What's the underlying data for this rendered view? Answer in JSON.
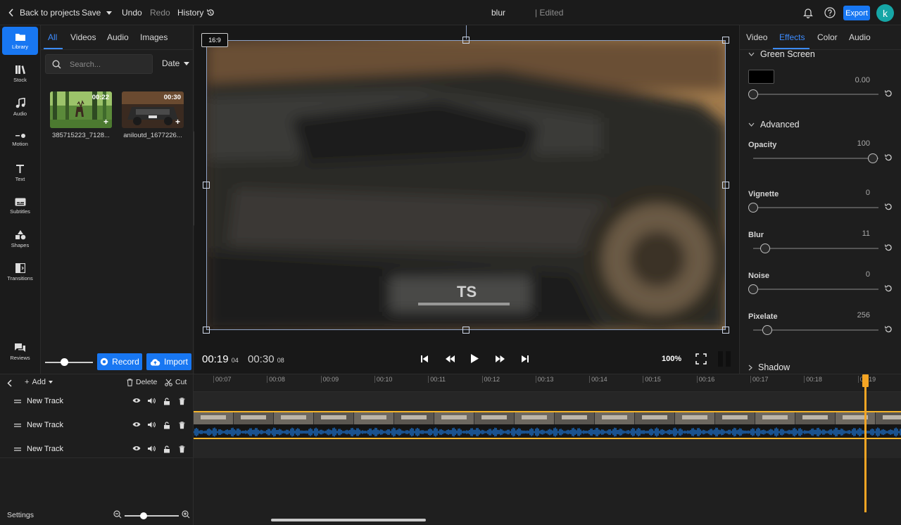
{
  "topbar": {
    "back_label": "Back to projects",
    "save_label": "Save",
    "undo_label": "Undo",
    "redo_label": "Redo",
    "history_label": "History",
    "project_title": "blur",
    "edit_status": "| Edited",
    "export_label": "Export",
    "avatar_initial": "k"
  },
  "rail": {
    "items": [
      {
        "label": "Library",
        "icon": "folder-icon"
      },
      {
        "label": "Stock",
        "icon": "books-icon"
      },
      {
        "label": "Audio",
        "icon": "music-note-icon"
      },
      {
        "label": "Motion",
        "icon": "motion-icon"
      },
      {
        "label": "Text",
        "icon": "text-icon"
      },
      {
        "label": "Subtitles",
        "icon": "subtitles-icon"
      },
      {
        "label": "Shapes",
        "icon": "shapes-icon"
      },
      {
        "label": "Transitions",
        "icon": "transitions-icon"
      },
      {
        "label": "Reviews",
        "icon": "chat-icon"
      }
    ]
  },
  "library": {
    "tabs": [
      "All",
      "Videos",
      "Audio",
      "Images"
    ],
    "search_placeholder": "Search...",
    "sort_label": "Date",
    "media": [
      {
        "name": "385715223_7128...",
        "duration": "00:22"
      },
      {
        "name": "aniloutd_1677226...",
        "duration": "00:30"
      }
    ],
    "record_label": "Record",
    "import_label": "Import",
    "thumb_size_level": 0.4
  },
  "preview": {
    "aspect_ratio": "16:9",
    "current_time": "00:19",
    "current_frame": "04",
    "total_time": "00:30",
    "total_frame": "08",
    "zoom": "100%",
    "watermark_text": "TS"
  },
  "props": {
    "tabs": [
      "Video",
      "Effects",
      "Color",
      "Audio"
    ],
    "active_tab": "Effects",
    "green_screen": {
      "title": "Green Screen",
      "value": "0.00",
      "swatch": "#000000"
    },
    "advanced_title": "Advanced",
    "sliders": [
      {
        "label": "Opacity",
        "value": "100",
        "level": 1.0
      },
      {
        "label": "Vignette",
        "value": "0",
        "level": 0.0
      },
      {
        "label": "Blur",
        "value": "11",
        "level": 0.1
      },
      {
        "label": "Noise",
        "value": "0",
        "level": 0.0
      },
      {
        "label": "Pixelate",
        "value": "256",
        "level": 0.12
      }
    ],
    "shadow_title": "Shadow"
  },
  "timeline": {
    "add_label": "Add",
    "delete_label": "Delete",
    "cut_label": "Cut",
    "tracks": [
      "New Track",
      "New Track",
      "New Track"
    ],
    "ruler": [
      "00:07",
      "00:08",
      "00:09",
      "00:10",
      "00:11",
      "00:12",
      "00:13",
      "00:14",
      "00:15",
      "00:16",
      "00:17",
      "00:18",
      "00:19"
    ],
    "settings_label": "Settings",
    "zoom_level": 0.35
  },
  "colors": {
    "accent": "#1877f2",
    "playhead": "#f5a524",
    "waveform": "#1e7be0",
    "avatar": "#16a6a6"
  }
}
